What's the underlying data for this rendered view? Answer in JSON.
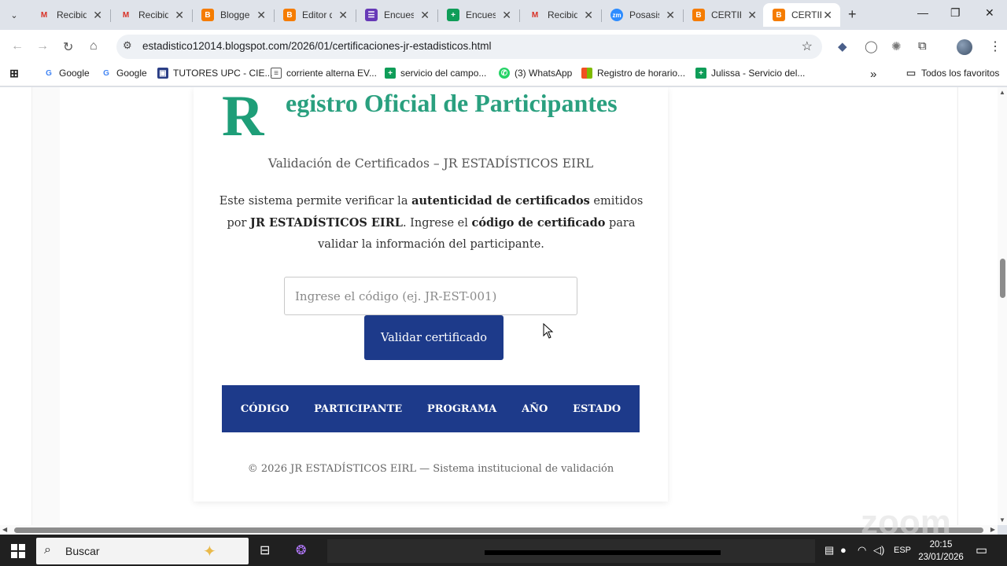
{
  "browser": {
    "tabs": [
      {
        "title": "Recibid",
        "icon": "gmail-icon",
        "active": false
      },
      {
        "title": "Recibid",
        "icon": "gmail-icon",
        "active": false
      },
      {
        "title": "Blogge",
        "icon": "blogger-icon",
        "active": false
      },
      {
        "title": "Editor d",
        "icon": "blogger-icon",
        "active": false
      },
      {
        "title": "Encues",
        "icon": "forms-icon",
        "active": false
      },
      {
        "title": "Encues",
        "icon": "sheets-icon",
        "active": false
      },
      {
        "title": "Recibid",
        "icon": "gmail-icon",
        "active": false
      },
      {
        "title": "Posasis",
        "icon": "zoom-icon",
        "active": false
      },
      {
        "title": "CERTIFI",
        "icon": "blogger-icon",
        "active": false
      },
      {
        "title": "CERTIFI",
        "icon": "blogger-icon",
        "active": true
      }
    ],
    "url": "estadistico12014.blogspot.com/2026/01/certificaciones-jr-estadisticos.html",
    "bookmarks": [
      {
        "label": "Google",
        "icon": "google-icon"
      },
      {
        "label": "Google",
        "icon": "google-icon"
      },
      {
        "label": "TUTORES UPC - CIE...",
        "icon": "upc-icon"
      },
      {
        "label": "corriente alterna EV...",
        "icon": "doc-icon"
      },
      {
        "label": "servicio del campo...",
        "icon": "sheets-icon"
      },
      {
        "label": "(3) WhatsApp",
        "icon": "whatsapp-icon"
      },
      {
        "label": "Registro de horario...",
        "icon": "microsoft-icon"
      },
      {
        "label": "Julissa - Servicio del...",
        "icon": "sheets-icon"
      }
    ],
    "all_bookmarks_label": "Todos los favoritos"
  },
  "page": {
    "dropcap": "R",
    "heading": "egistro Oficial de Participantes",
    "subtitle": "Validación de Certificados – JR ESTADÍSTICOS EIRL",
    "desc": {
      "p1": "Este sistema permite verificar la ",
      "b1": "autenticidad de certificados",
      "p2": " emitidos por ",
      "b2": "JR ESTADÍSTICOS EIRL",
      "p3": ". Ingrese el ",
      "b3": "código de certificado",
      "p4": " para validar la información del participante."
    },
    "input_placeholder": "Ingrese el código (ej. JR-EST-001)",
    "input_value": "",
    "button_label": "Validar certificado",
    "table_headers": [
      "CÓDIGO",
      "PARTICIPANTE",
      "PROGRAMA",
      "AÑO",
      "ESTADO"
    ],
    "footer": "© 2026 JR ESTADÍSTICOS EIRL — Sistema institucional de validación",
    "accent_color": "#2aa07f",
    "primary_color": "#1d3a8a"
  },
  "taskbar": {
    "search_label": "Buscar",
    "language": "ESP",
    "time": "20:15",
    "date": "23/01/2026"
  }
}
